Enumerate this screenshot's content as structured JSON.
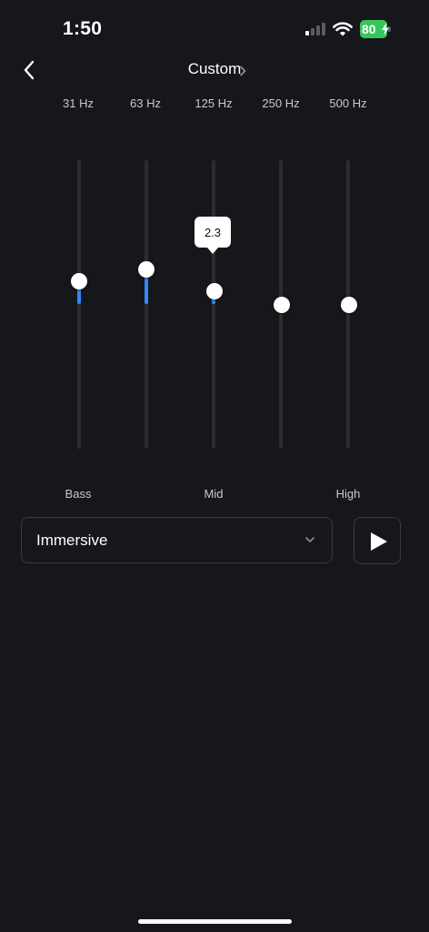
{
  "status_bar": {
    "time": "1:50",
    "battery": "80",
    "cell_bars_on": 1,
    "cell_bars_total": 4
  },
  "header": {
    "back_icon": "chevron-left-icon",
    "title": "Custom",
    "title_icon": "chevron-right-icon"
  },
  "equalizer": {
    "bands": [
      {
        "frequency": "31 Hz",
        "level": 0.16
      },
      {
        "frequency": "63 Hz",
        "level": 0.24
      },
      {
        "frequency": "125 Hz",
        "level": 0.09
      },
      {
        "frequency": "250 Hz",
        "level": 0.0
      },
      {
        "frequency": "500 Hz",
        "level": 0.0
      }
    ],
    "active_band_value": "2.3",
    "band_groups": [
      "Bass",
      "Mid",
      "High"
    ],
    "fill_color": "#2f8af5"
  },
  "preset": {
    "value": "Immersive",
    "icon": "chevron-down-icon"
  },
  "play": {
    "icon": "play-icon"
  },
  "colors": {
    "background": "#16171b",
    "accent": "#2f8af5",
    "battery": "#35c759"
  }
}
